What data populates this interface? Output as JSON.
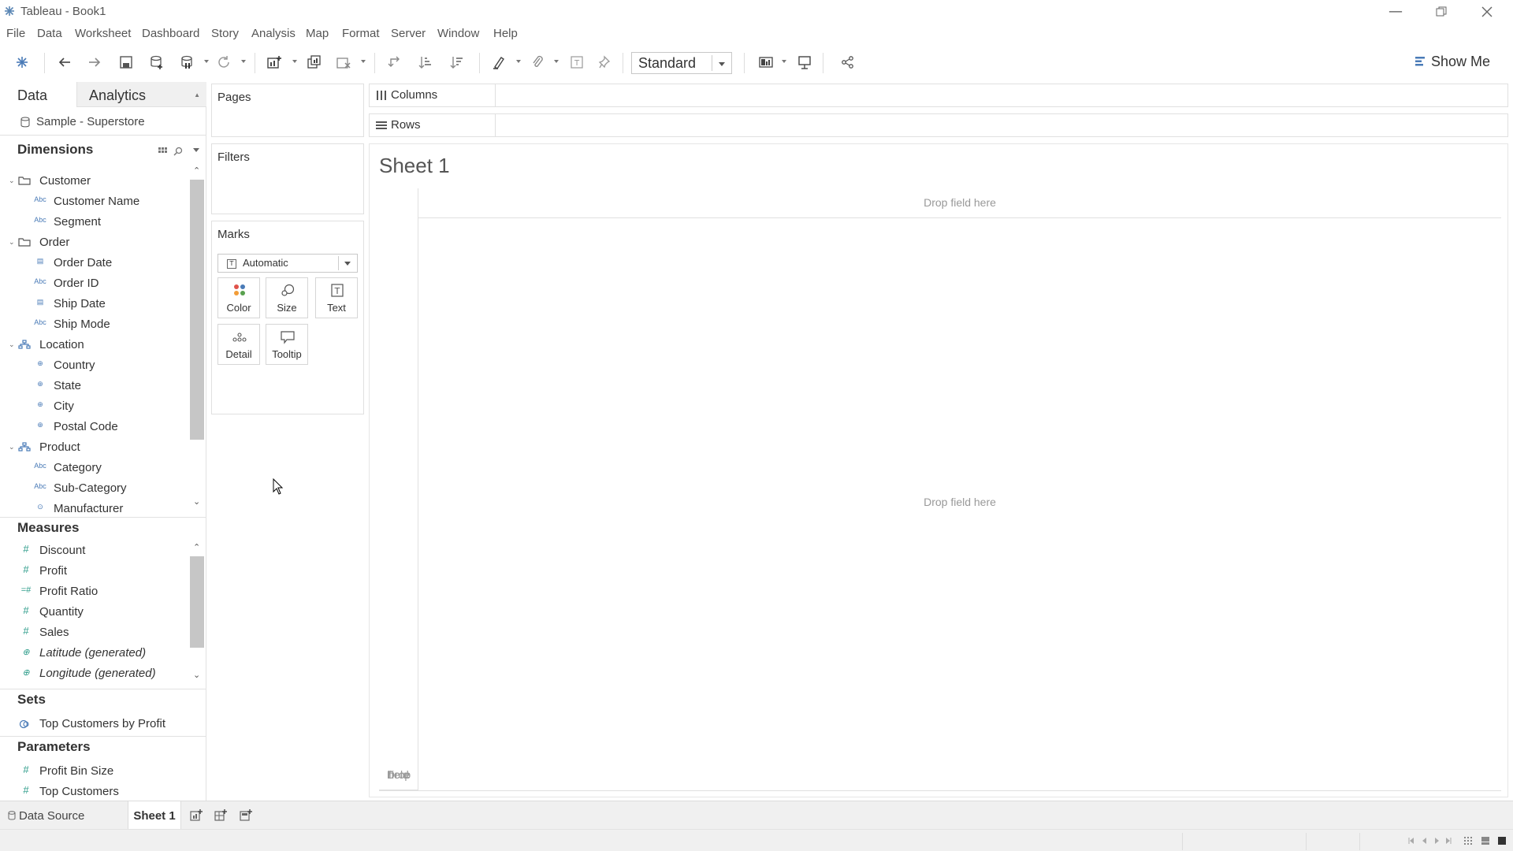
{
  "window": {
    "title": "Tableau - Book1",
    "controls": [
      "minimize",
      "restore",
      "close"
    ]
  },
  "menu": [
    "File",
    "Data",
    "Worksheet",
    "Dashboard",
    "Story",
    "Analysis",
    "Map",
    "Format",
    "Server",
    "Window",
    "Help"
  ],
  "toolbar": {
    "fit_value": "Standard",
    "show_me_label": "Show Me"
  },
  "data_pane": {
    "tabs": {
      "data": "Data",
      "analytics": "Analytics"
    },
    "datasource": "Sample - Superstore",
    "dimensions_header": "Dimensions",
    "dimensions": [
      {
        "label": "Customer",
        "type": "folder"
      },
      {
        "label": "Customer Name",
        "type": "string"
      },
      {
        "label": "Segment",
        "type": "string"
      },
      {
        "label": "Order",
        "type": "folder"
      },
      {
        "label": "Order Date",
        "type": "date"
      },
      {
        "label": "Order ID",
        "type": "string"
      },
      {
        "label": "Ship Date",
        "type": "date"
      },
      {
        "label": "Ship Mode",
        "type": "string"
      },
      {
        "label": "Location",
        "type": "hierarchy"
      },
      {
        "label": "Country",
        "type": "geo"
      },
      {
        "label": "State",
        "type": "geo"
      },
      {
        "label": "City",
        "type": "geo"
      },
      {
        "label": "Postal Code",
        "type": "geo"
      },
      {
        "label": "Product",
        "type": "hierarchy"
      },
      {
        "label": "Category",
        "type": "string"
      },
      {
        "label": "Sub-Category",
        "type": "string"
      },
      {
        "label": "Manufacturer",
        "type": "group"
      }
    ],
    "measures_header": "Measures",
    "measures": [
      {
        "label": "Discount",
        "type": "number"
      },
      {
        "label": "Profit",
        "type": "number"
      },
      {
        "label": "Profit Ratio",
        "type": "calc"
      },
      {
        "label": "Quantity",
        "type": "number"
      },
      {
        "label": "Sales",
        "type": "number"
      },
      {
        "label": "Latitude (generated)",
        "type": "geo"
      },
      {
        "label": "Longitude (generated)",
        "type": "geo"
      }
    ],
    "sets_header": "Sets",
    "sets": [
      {
        "label": "Top Customers by Profit"
      }
    ],
    "parameters_header": "Parameters",
    "parameters": [
      {
        "label": "Profit Bin Size"
      },
      {
        "label": "Top Customers"
      }
    ]
  },
  "cards": {
    "pages": "Pages",
    "filters": "Filters",
    "marks": "Marks",
    "mark_type": "Automatic",
    "mark_buttons": [
      "Color",
      "Size",
      "Text",
      "Detail",
      "Tooltip"
    ]
  },
  "shelves": {
    "columns": "Columns",
    "rows": "Rows"
  },
  "view": {
    "sheet_title": "Sheet 1",
    "col_drop": "Drop field here",
    "row_drop_lines": [
      "Drop",
      "field",
      "here"
    ],
    "view_drop": "Drop field here"
  },
  "sheet_tabs": {
    "data_source": "Data Source",
    "sheet": "Sheet 1"
  },
  "colors": {
    "accent_blue": "#4a7bb7",
    "measure_teal": "#2d9c8a",
    "panel_bg": "#f0f0f0"
  }
}
